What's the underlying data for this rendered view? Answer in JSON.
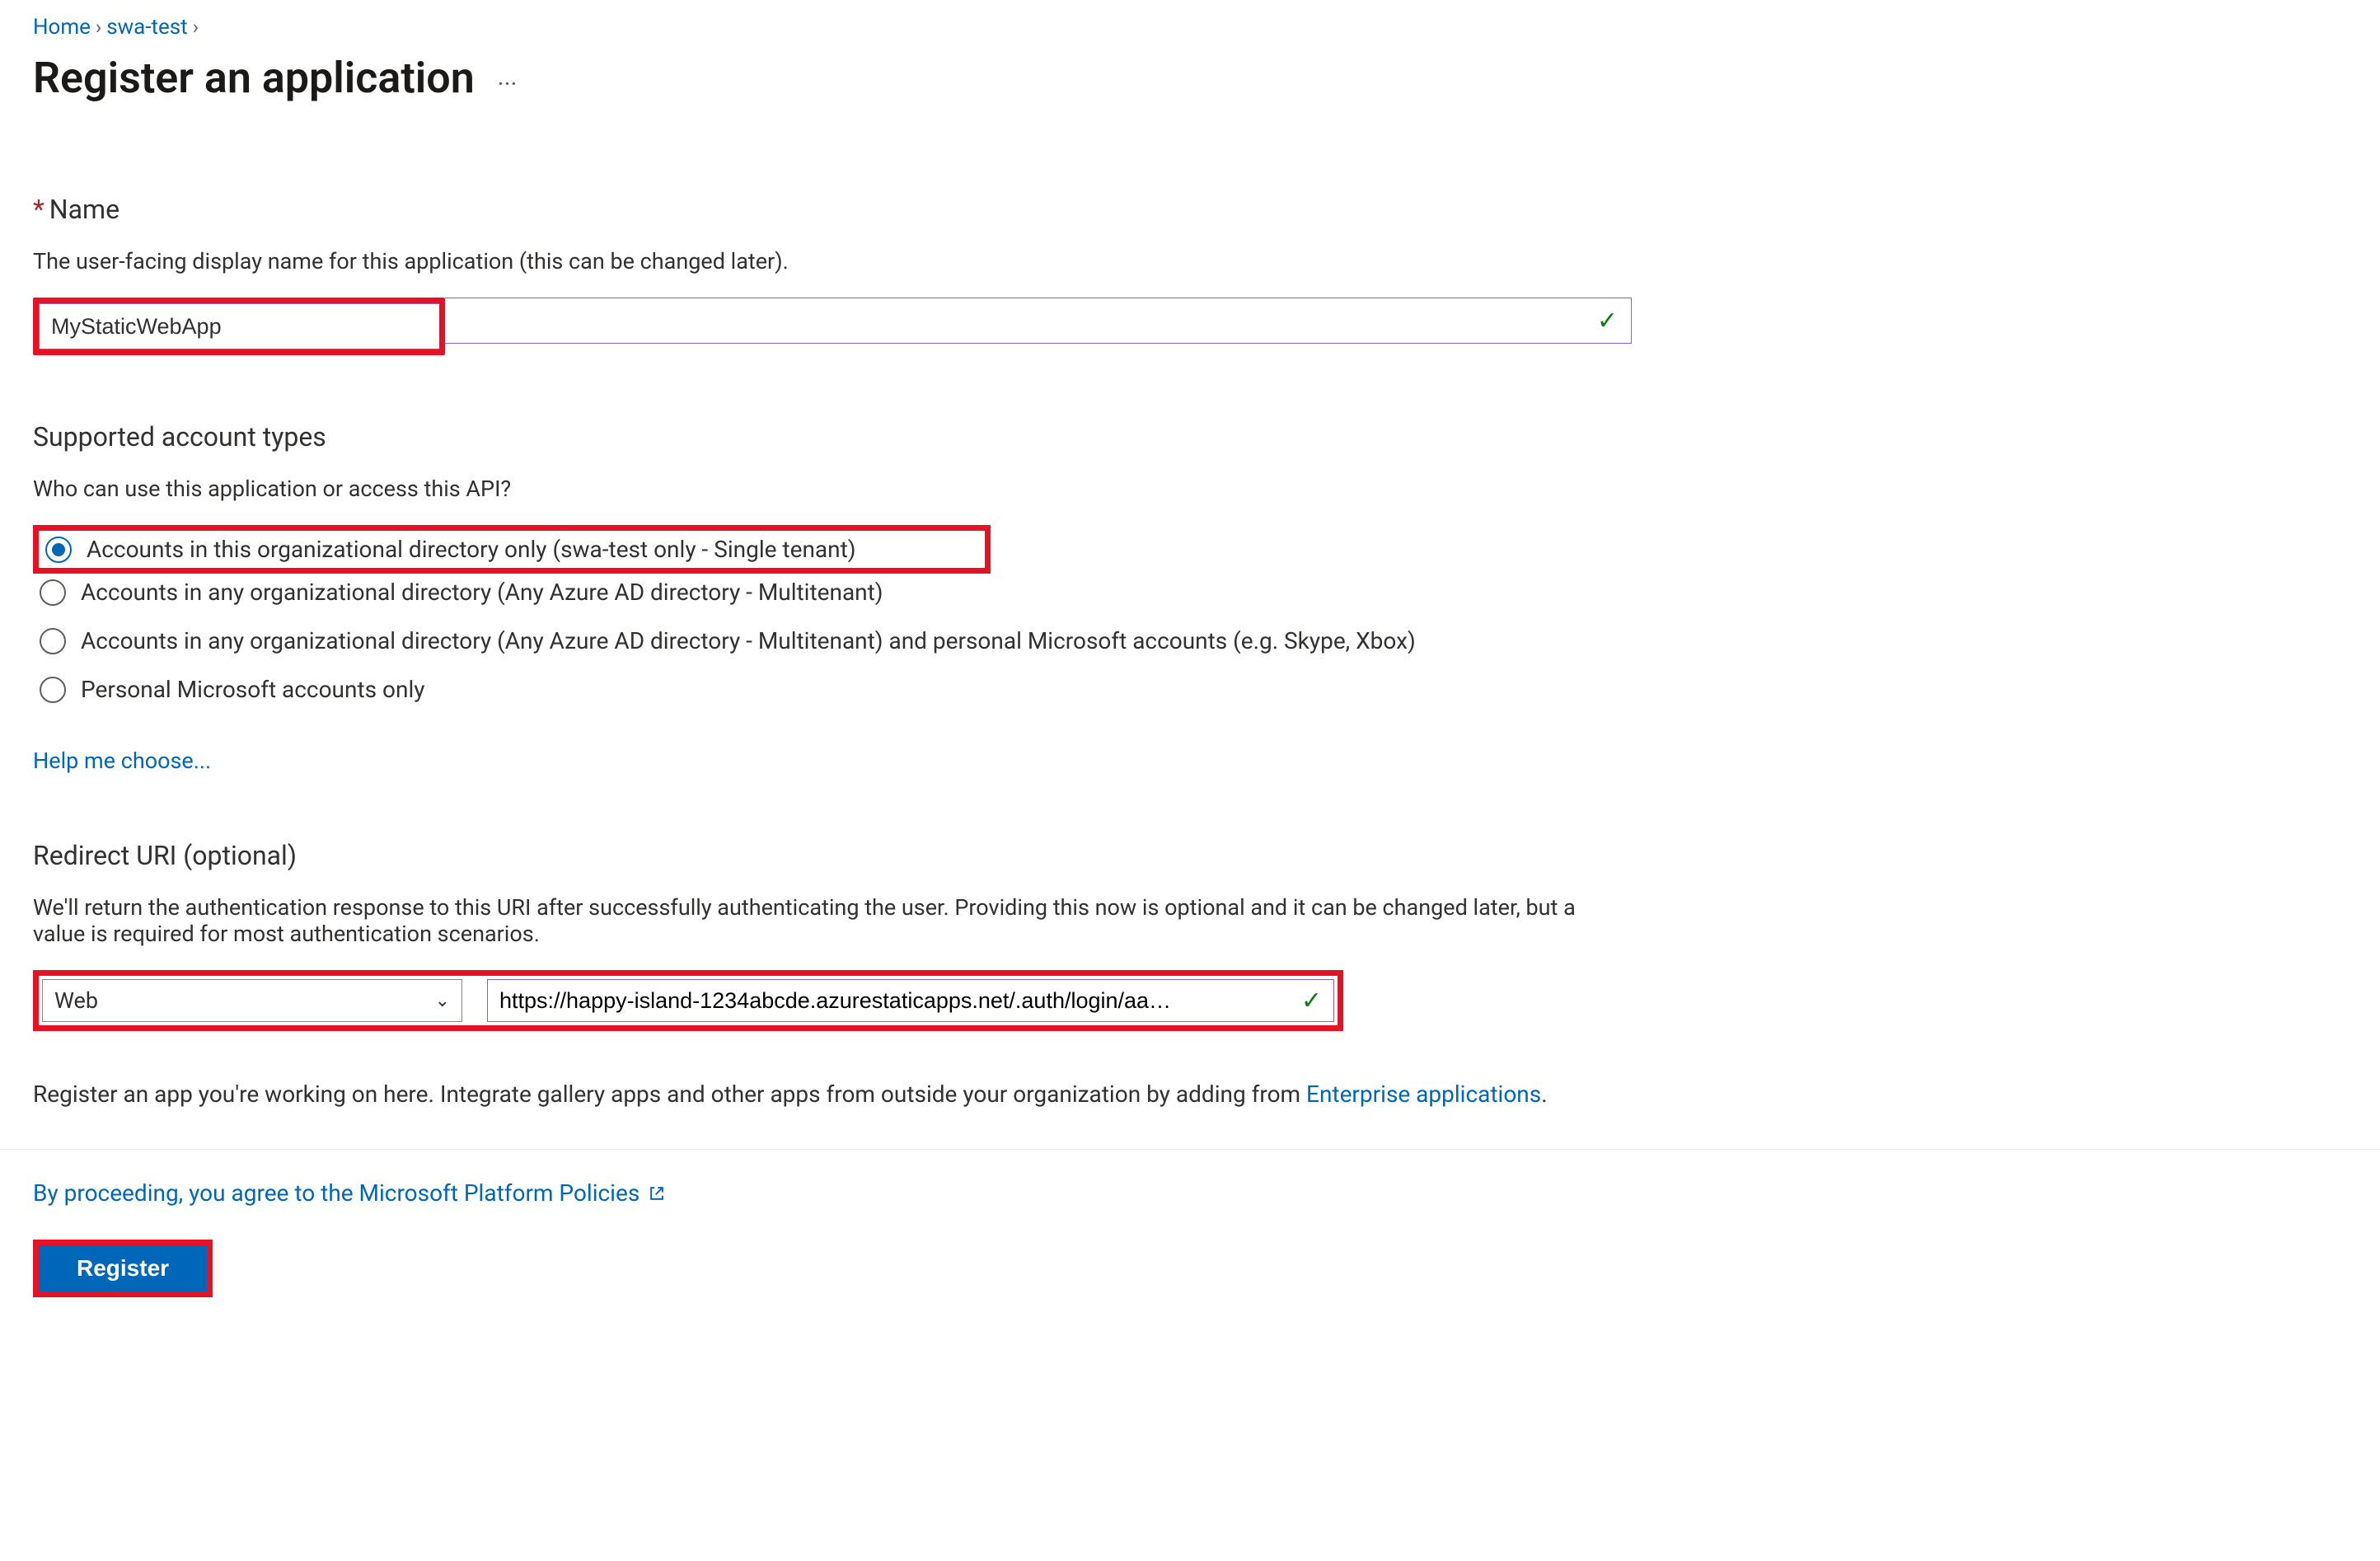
{
  "breadcrumb": {
    "items": [
      "Home",
      "swa-test"
    ]
  },
  "title": "Register an application",
  "sections": {
    "name": {
      "label": "Name",
      "description": "The user-facing display name for this application (this can be changed later).",
      "value": "MyStaticWebApp"
    },
    "account_types": {
      "label": "Supported account types",
      "question": "Who can use this application or access this API?",
      "options": [
        "Accounts in this organizational directory only (swa-test only - Single tenant)",
        "Accounts in any organizational directory (Any Azure AD directory - Multitenant)",
        "Accounts in any organizational directory (Any Azure AD directory - Multitenant) and personal Microsoft accounts (e.g. Skype, Xbox)",
        "Personal Microsoft accounts only"
      ],
      "selected_index": 0,
      "help_link": "Help me choose..."
    },
    "redirect": {
      "label": "Redirect URI (optional)",
      "description": "We'll return the authentication response to this URI after successfully authenticating the user. Providing this now is optional and it can be changed later, but a value is required for most authentication scenarios.",
      "platform_selected": "Web",
      "uri_value": "https://happy-island-1234abcde.azurestaticapps.net/.auth/login/aa…"
    }
  },
  "integrate_text_pre": "Register an app you're working on here. Integrate gallery apps and other apps from outside your organization by adding from ",
  "integrate_link": "Enterprise applications",
  "policy_text": "By proceeding, you agree to the Microsoft Platform Policies",
  "register_label": "Register"
}
